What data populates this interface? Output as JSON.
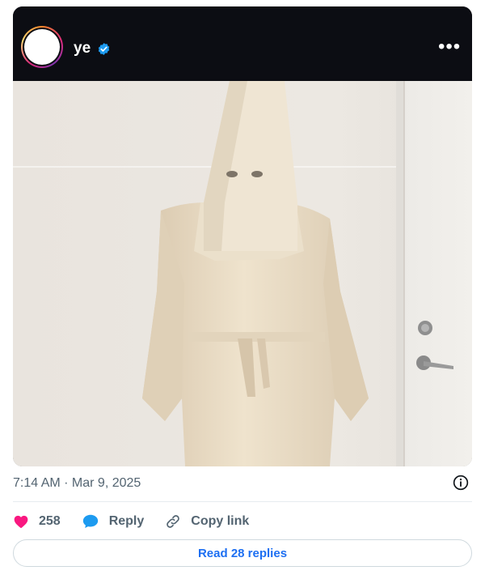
{
  "post": {
    "username": "ye",
    "timestamp": "7:14 AM · Mar 9, 2025",
    "image_alt": "Photo of a white hooded robe with a pointed hood hanging against a wall beside a door"
  },
  "actions": {
    "likes": "258",
    "reply_label": "Reply",
    "copy_link_label": "Copy link"
  },
  "footer": {
    "read_replies_label": "Read 28 replies"
  },
  "colors": {
    "heart": "#f91880",
    "reply_bubble": "#1d9bf0",
    "link_blue": "#1d6ff2",
    "verified": "#1d9bf0"
  },
  "icons": [
    "avatar-ring",
    "verified-badge-icon",
    "more-icon",
    "info-icon",
    "heart-icon",
    "reply-icon",
    "link-icon"
  ]
}
